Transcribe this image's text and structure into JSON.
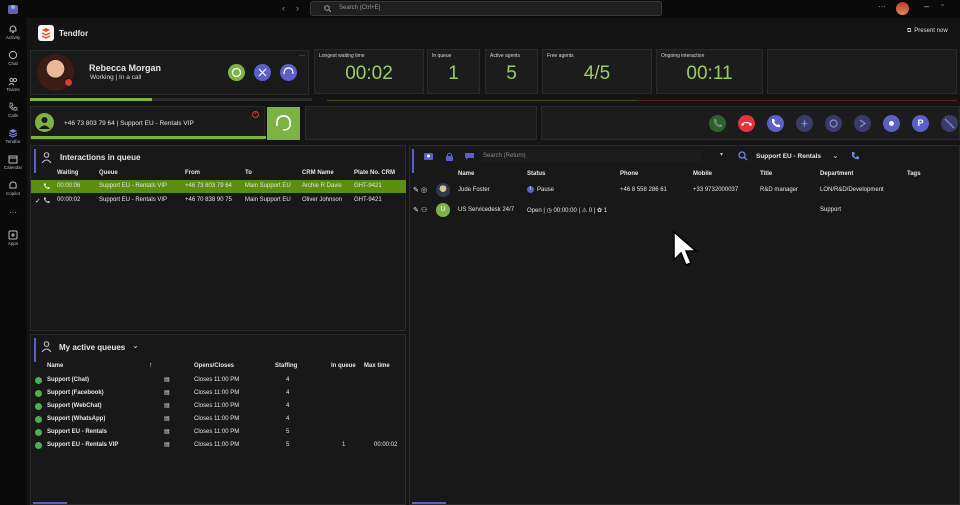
{
  "topbar": {
    "search_placeholder": "Search (Ctrl+E)"
  },
  "rail": {
    "items": [
      {
        "label": "Activity",
        "icon": "bell-icon"
      },
      {
        "label": "Chat",
        "icon": "chat-icon"
      },
      {
        "label": "Teams",
        "icon": "teams-icon"
      },
      {
        "label": "Calls",
        "icon": "phone-icon"
      },
      {
        "label": "Tendfor",
        "icon": "tendfor-icon"
      },
      {
        "label": "Calendar",
        "icon": "calendar-icon"
      },
      {
        "label": "Copilot",
        "icon": "copilot-icon"
      },
      {
        "label": "Apps",
        "icon": "apps-icon"
      }
    ]
  },
  "header": {
    "app_title": "Tendfor",
    "present_now": "Present now"
  },
  "agent": {
    "name": "Rebecca Morgan",
    "status": "Working | In a call"
  },
  "stats": [
    {
      "label": "Longest waiting time",
      "value": "00:02"
    },
    {
      "label": "In queue",
      "value": "1"
    },
    {
      "label": "Active agents",
      "value": "5"
    },
    {
      "label": "Free agents",
      "value": "4/5"
    },
    {
      "label": "Ongoing interaction",
      "value": "00:11"
    }
  ],
  "call": {
    "text": "+46 73 803 79 64 | Support EU - Rentals VIP"
  },
  "queue_panel": {
    "title": "Interactions in queue",
    "columns": [
      "Waiting",
      "Queue",
      "From",
      "To",
      "CRM Name",
      "Plate No. CRM"
    ],
    "rows": [
      {
        "waiting": "00:00:06",
        "queue": "Support EU - Rentals VIP",
        "from": "+46 73 803 79 64",
        "to": "Main Support EU",
        "crm": "Archie R Davis",
        "plate": "GHT-9421"
      },
      {
        "waiting": "00:00:02",
        "queue": "Support EU - Rentals VIP",
        "from": "+46 70 838 90 75",
        "to": "Main Support EU",
        "crm": "Oliver Johnson",
        "plate": "GHT-9421"
      }
    ]
  },
  "active_queues": {
    "title": "My active queues",
    "columns": [
      "Name",
      "Opens/Closes",
      "Staffing",
      "In queue",
      "Max time"
    ],
    "rows": [
      {
        "name": "Support (Chat)",
        "closes": "Closes 11:00 PM",
        "staffing": "4",
        "in_queue": "",
        "max_time": ""
      },
      {
        "name": "Support (Facebook)",
        "closes": "Closes 11:00 PM",
        "staffing": "4",
        "in_queue": "",
        "max_time": ""
      },
      {
        "name": "Support (WebChat)",
        "closes": "Closes 11:00 PM",
        "staffing": "4",
        "in_queue": "",
        "max_time": ""
      },
      {
        "name": "Support (WhatsApp)",
        "closes": "Closes 11:00 PM",
        "staffing": "4",
        "in_queue": "",
        "max_time": ""
      },
      {
        "name": "Support EU - Rentals",
        "closes": "Closes 11:00 PM",
        "staffing": "5",
        "in_queue": "",
        "max_time": ""
      },
      {
        "name": "Support EU - Rentals VIP",
        "closes": "Closes 11:00 PM",
        "staffing": "5",
        "in_queue": "1",
        "max_time": "00:00:02"
      }
    ]
  },
  "directory": {
    "search_placeholder": "Search (Return)",
    "filter": "Support EU - Rentals",
    "columns": [
      "Name",
      "Status",
      "Phone",
      "Mobile",
      "Title",
      "Department",
      "Tags"
    ],
    "rows": [
      {
        "avatar": "",
        "name": "Jude Foster",
        "status": "Pause",
        "phone": "+46 8 558 286 61",
        "mobile": "+33 9732000037",
        "title": "R&D manager",
        "department": "LON/R&D/Development",
        "tags": ""
      },
      {
        "avatar": "U",
        "name": "US Servicedesk 24/7",
        "status": "Open | ◷ 00:00:00 | ⚠ 0 | ✿ 1",
        "phone": "",
        "mobile": "",
        "title": "",
        "department": "Support",
        "tags": ""
      }
    ]
  },
  "colors": {
    "accent_green": "#8bc34a",
    "highlight_row": "#5b8f12",
    "purple": "#5b5fc7",
    "end_call_red": "#e0353b"
  }
}
